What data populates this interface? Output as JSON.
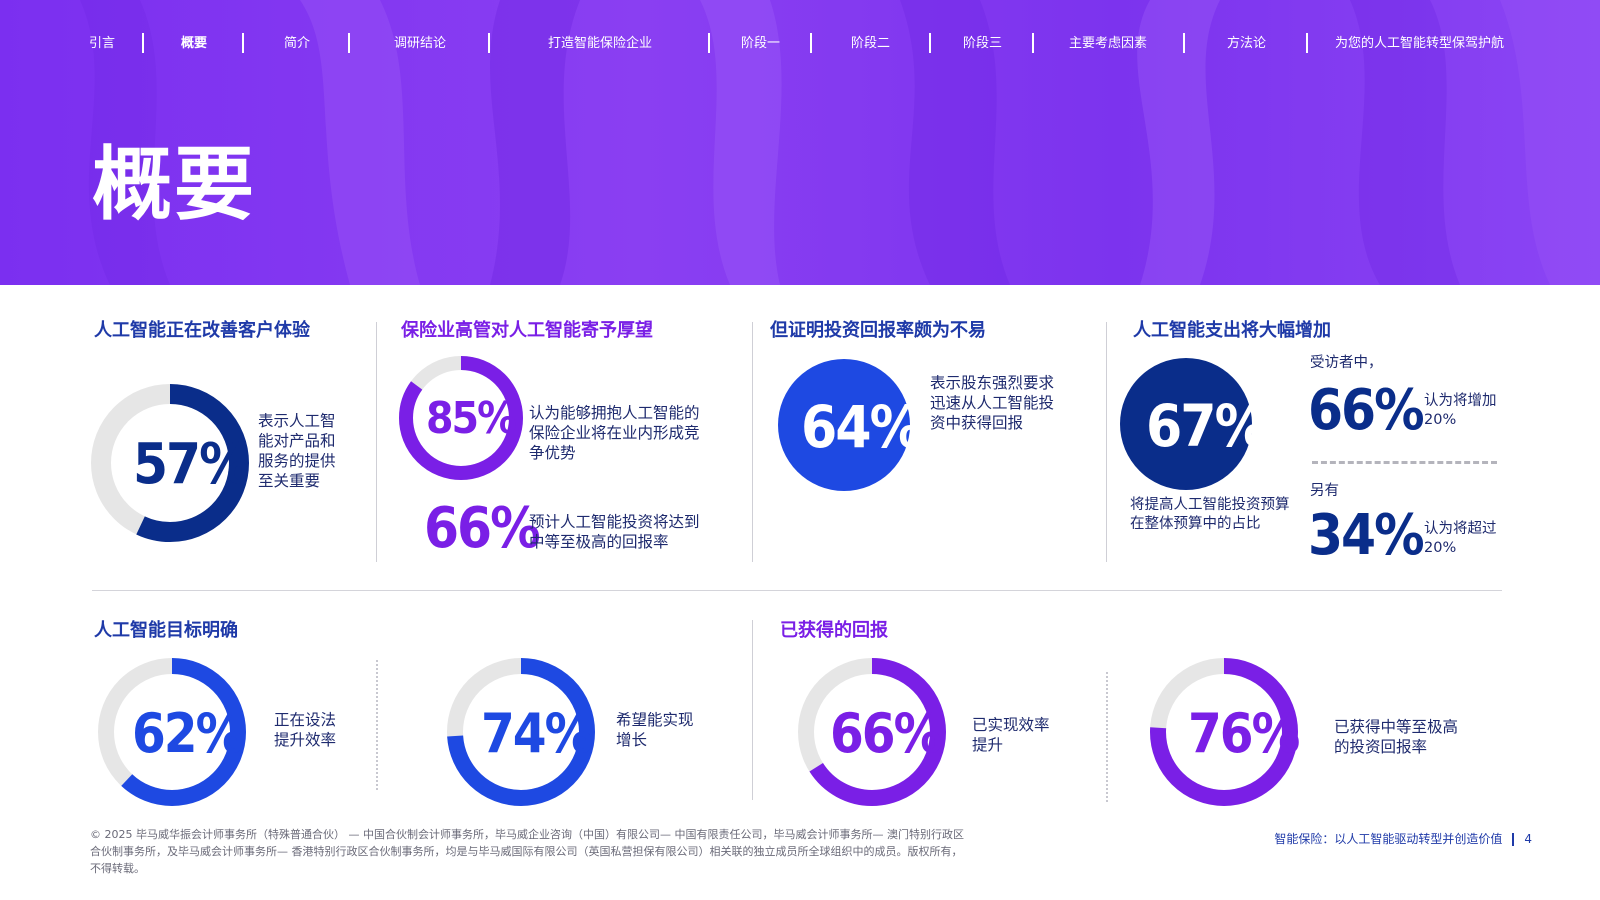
{
  "nav": {
    "items": [
      "引言",
      "概要",
      "简介",
      "调研结论",
      "打造智能保险企业",
      "阶段一",
      "阶段二",
      "阶段三",
      "主要考虑因素",
      "方法论",
      "为您的人工智能转型保驾护航"
    ],
    "active": "概要"
  },
  "page_title": "概要",
  "sections": {
    "cx": {
      "title": "人工智能正在改善客户体验",
      "pct": "57%",
      "value": 57,
      "desc": "表示人工智能对产品和服务的提供至关重要"
    },
    "expect": {
      "title": "保险业高管对人工智能寄予厚望",
      "stat1": {
        "pct": "85%",
        "value": 85,
        "desc": "认为能够拥抱人工智能的保险企业将在业内形成竞争优势"
      },
      "stat2": {
        "pct": "66%",
        "desc": "预计人工智能投资将达到中等至极高的回报率"
      }
    },
    "roi": {
      "title": "但证明投资回报率颇为不易",
      "pct": "64%",
      "desc": "表示股东强烈要求迅速从人工智能投资中获得回报"
    },
    "spend": {
      "title": "人工智能支出将大幅增加",
      "pct": "67%",
      "desc": "将提高人工智能投资预算在整体预算中的占比",
      "lead1": "受访者中，",
      "stat1": {
        "pct": "66%",
        "desc": "认为将增加20%"
      },
      "lead2": "另有",
      "stat2": {
        "pct": "34%",
        "desc": "认为将超过20%"
      }
    },
    "goals": {
      "title": "人工智能目标明确",
      "stat1": {
        "pct": "62%",
        "value": 62,
        "desc": "正在设法提升效率"
      },
      "stat2": {
        "pct": "74%",
        "value": 74,
        "desc": "希望能实现增长"
      }
    },
    "returns": {
      "title": "已获得的回报",
      "stat1": {
        "pct": "66%",
        "value": 66,
        "desc": "已实现效率提升"
      },
      "stat2": {
        "pct": "76%",
        "value": 76,
        "desc": "已获得中等至极高的投资回报率"
      }
    }
  },
  "footer": {
    "legal": "© 2025 毕马威华振会计师事务所（特殊普通合伙） — 中国合伙制会计师事务所，毕马威企业咨询（中国）有限公司— 中国有限责任公司，毕马威会计师事务所— 澳门特别行政区合伙制事务所，及毕马威会计师事务所— 香港特别行政区合伙制事务所，均是与毕马威国际有限公司（英国私营担保有限公司）相关联的独立成员所全球组织中的成员。版权所有，不得转载。",
    "doc_title": "智能保险：以人工智能驱动转型并创造价值",
    "page_number": "4"
  },
  "colors": {
    "hero_purple": "#7b2ff0",
    "navy": "#0a2d8a",
    "blue": "#1e49e2",
    "purple": "#7a1fe6",
    "ring_track": "#e6e6e6"
  }
}
